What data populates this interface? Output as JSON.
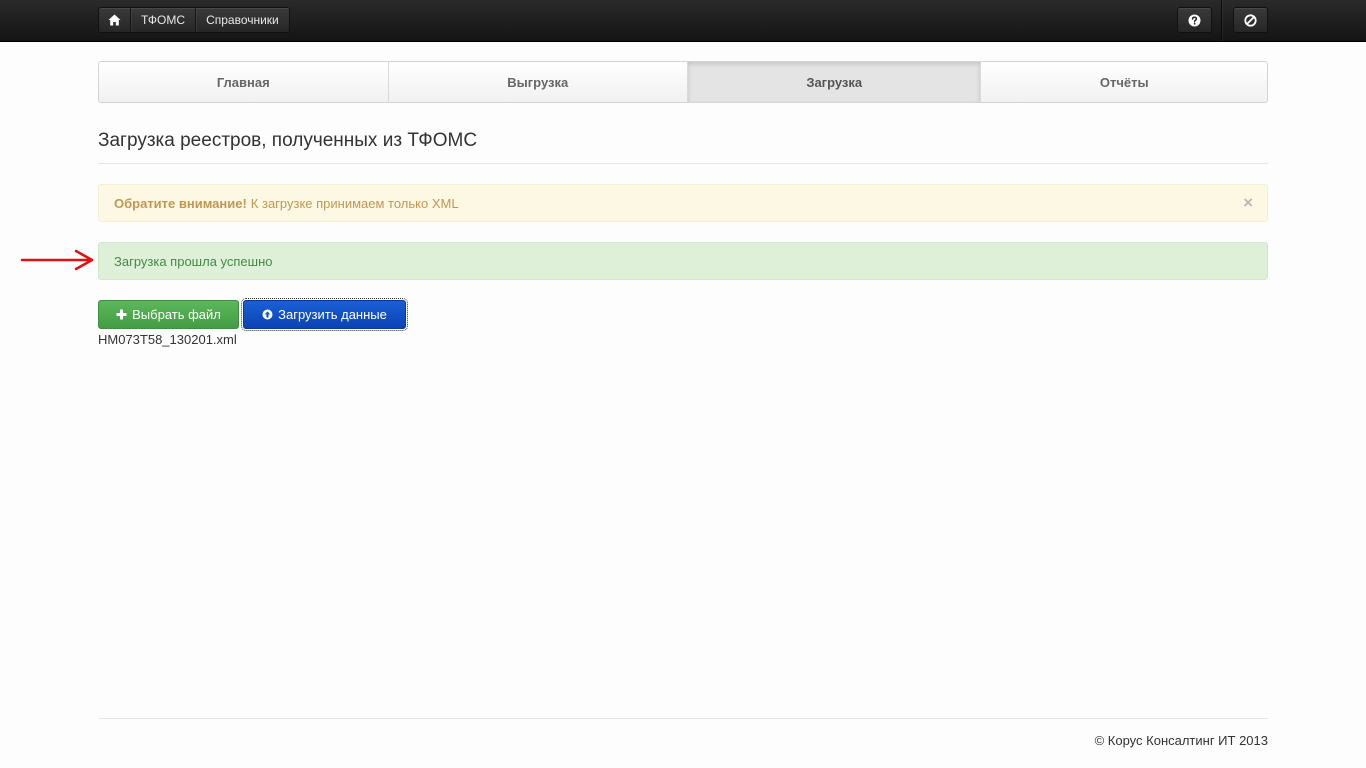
{
  "navbar": {
    "home_icon": "home-icon",
    "items": [
      "ТФОМС",
      "Справочники"
    ],
    "help_icon": "question-circle-icon",
    "logout_icon": "ban-circle-icon"
  },
  "tabs": [
    {
      "label": "Главная",
      "active": false
    },
    {
      "label": "Выгрузка",
      "active": false
    },
    {
      "label": "Загрузка",
      "active": true
    },
    {
      "label": "Отчёты",
      "active": false
    }
  ],
  "page": {
    "title": "Загрузка реестров, полученных из ТФОМС"
  },
  "alerts": {
    "warning": {
      "strong": "Обратите внимание!",
      "text": "К загрузке принимаем только XML",
      "close": "×"
    },
    "success": {
      "text": "Загрузка прошла успешно"
    }
  },
  "actions": {
    "choose_file": "Выбрать файл",
    "choose_icon": "plus-icon",
    "upload": "Загрузить данные",
    "upload_icon": "upload-circle-icon"
  },
  "file": {
    "name": "HM073T58_130201.xml"
  },
  "footer": {
    "text": "© Корус Консалтинг ИТ 2013"
  },
  "colors": {
    "navbar": "#1b1b1b",
    "success_button": "#51a351",
    "primary_button": "#0b4fcb",
    "warning_bg": "#fcf8e3",
    "warning_text": "#c09853",
    "success_bg": "#dff0d8",
    "success_text": "#468847",
    "annotation_arrow": "#e01010"
  }
}
